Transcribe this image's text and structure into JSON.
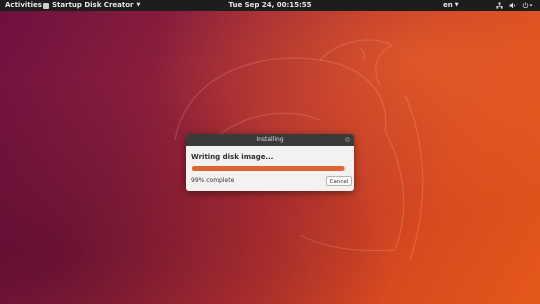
{
  "top_panel": {
    "activities": "Activities",
    "app_name": "Startup Disk Creator",
    "clock": "Tue Sep 24, 00:15:55",
    "language": "en",
    "tray_icons": [
      "network-wired-icon",
      "volume-icon",
      "power-icon"
    ]
  },
  "dialog": {
    "title": "Installing",
    "heading": "Writing disk image...",
    "progress_fraction": 0.99,
    "progress_text": "99% complete",
    "cancel_label": "Cancel"
  },
  "colors": {
    "accent": "#e06535",
    "panel": "#1d1d1d",
    "dialog_titlebar": "#3a3a38"
  }
}
